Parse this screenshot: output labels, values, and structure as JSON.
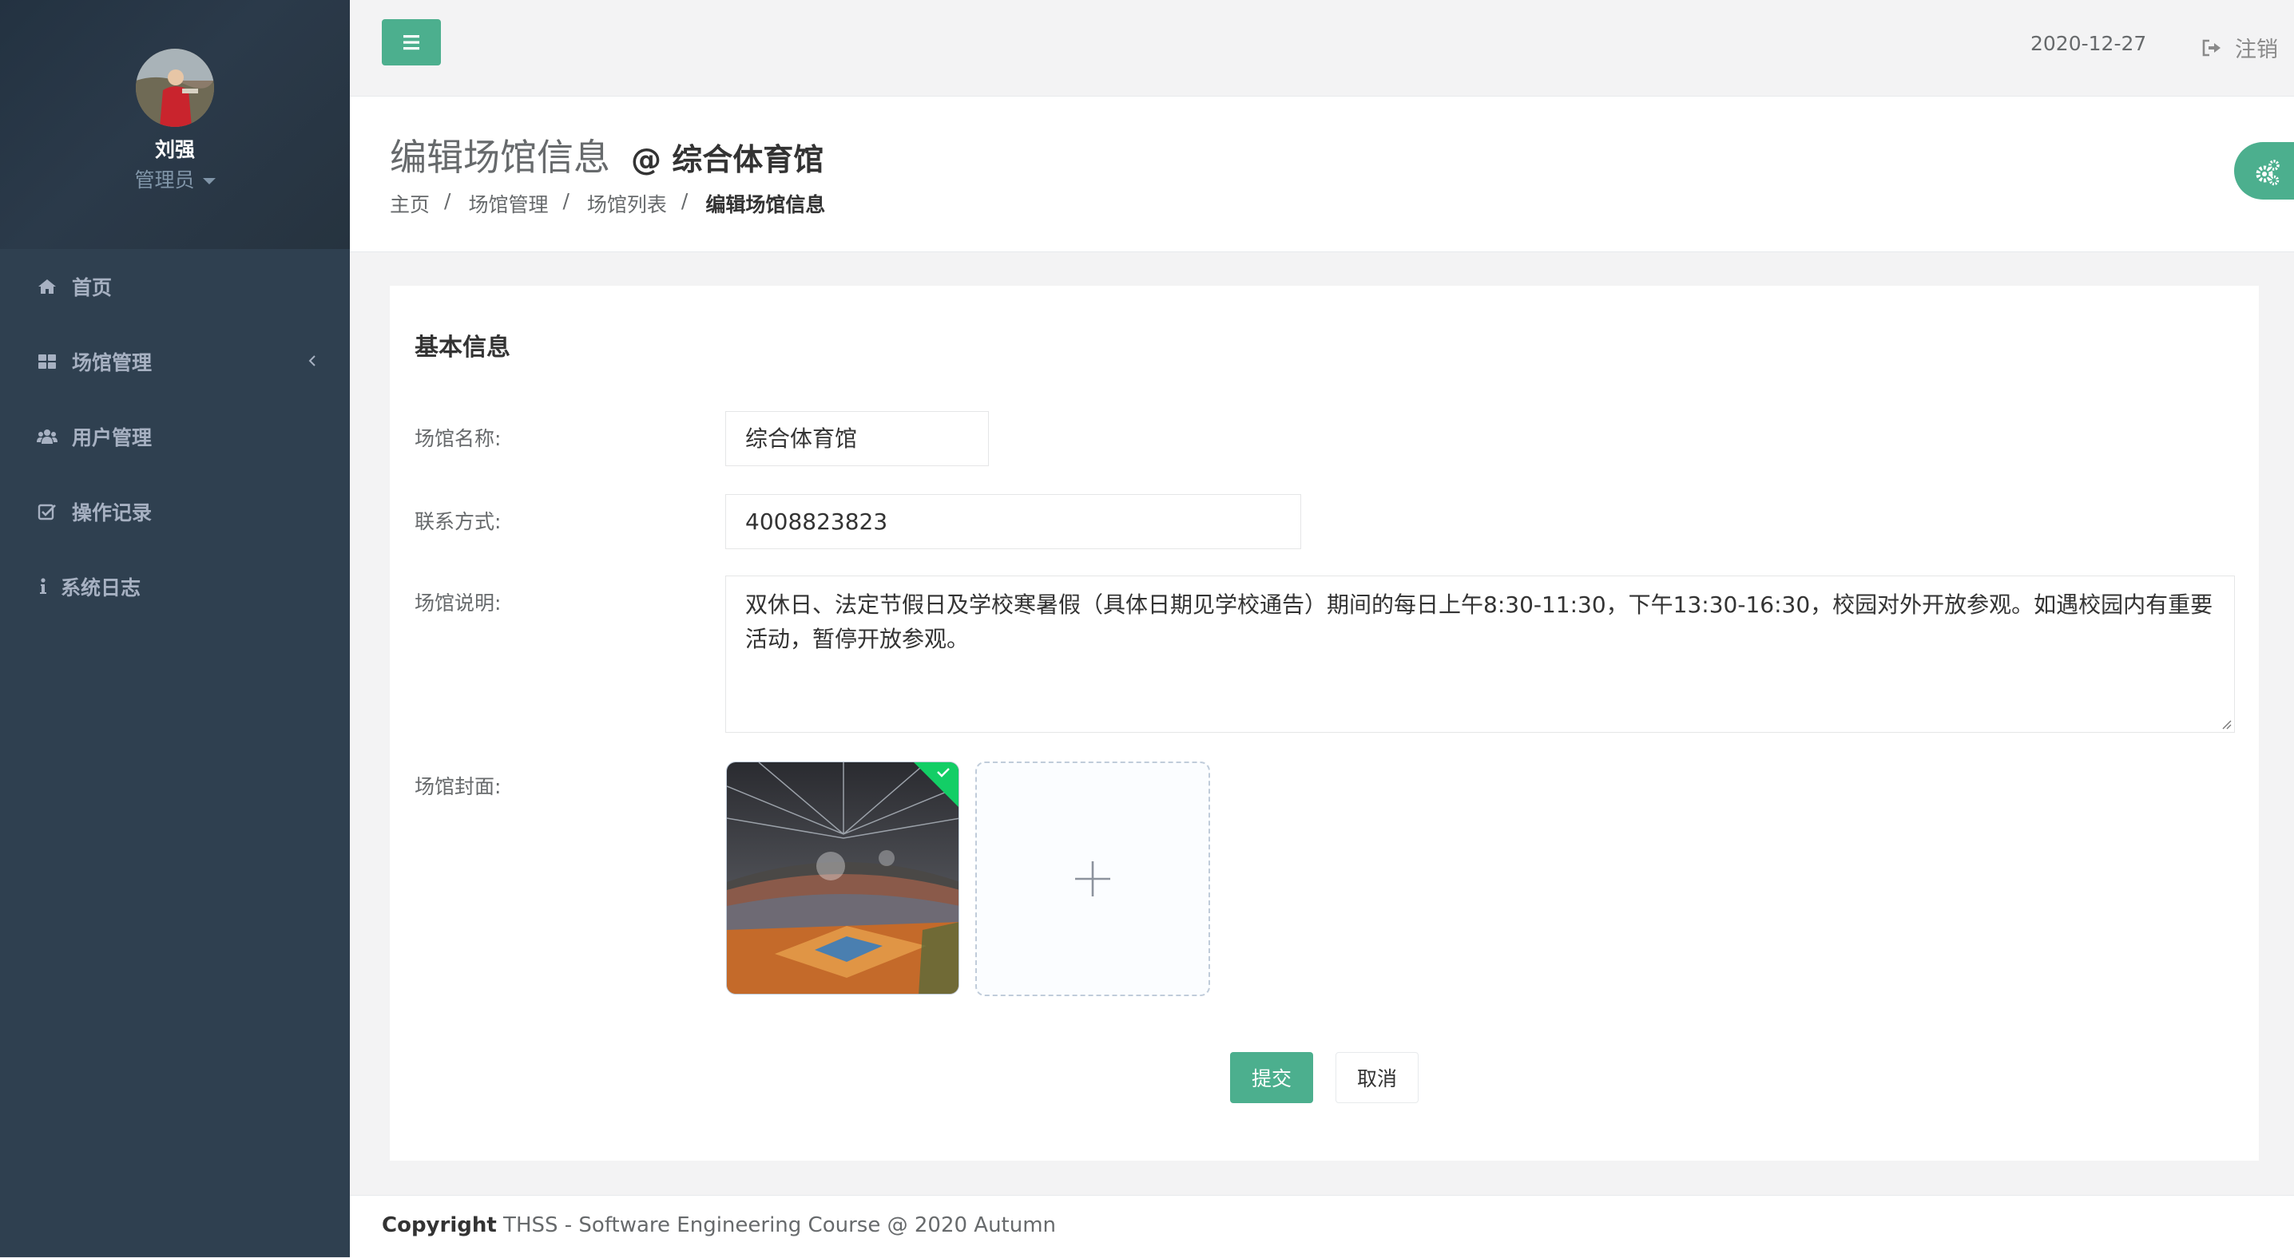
{
  "topbar": {
    "date": "2020-12-27",
    "logout_label": "注销"
  },
  "profile": {
    "name": "刘强",
    "role": "管理员"
  },
  "sidebar": {
    "items": [
      {
        "label": "首页",
        "icon": "home-icon"
      },
      {
        "label": "场馆管理",
        "icon": "grid-icon"
      },
      {
        "label": "用户管理",
        "icon": "users-icon"
      },
      {
        "label": "操作记录",
        "icon": "check-square-icon"
      },
      {
        "label": "系统日志",
        "icon": "info-icon"
      }
    ]
  },
  "heading": {
    "title": "编辑场馆信息",
    "subtitle": "@ 综合体育馆",
    "breadcrumb": [
      "主页",
      "场馆管理",
      "场馆列表",
      "编辑场馆信息"
    ],
    "breadcrumb_separator": "/"
  },
  "form": {
    "section_title": "基本信息",
    "name_label": "场馆名称:",
    "name_value": "综合体育馆",
    "contact_label": "联系方式:",
    "contact_value": "4008823823",
    "description_label": "场馆说明:",
    "description_value": "双休日、法定节假日及学校寒暑假（具体日期见学校通告）期间的每日上午8:30-11:30，下午13:30-16:30，校园对外开放参观。如遇校园内有重要活动，暂停开放参观。",
    "cover_label": "场馆封面:",
    "submit_label": "提交",
    "cancel_label": "取消"
  },
  "footer": {
    "copyright_bold": "Copyright",
    "copyright_rest": " THSS - Software Engineering Course @ 2020 Autumn"
  },
  "colors": {
    "sidebar_bg": "#2f4050",
    "accent": "#4caf8e",
    "page_bg": "#f3f3f4"
  }
}
